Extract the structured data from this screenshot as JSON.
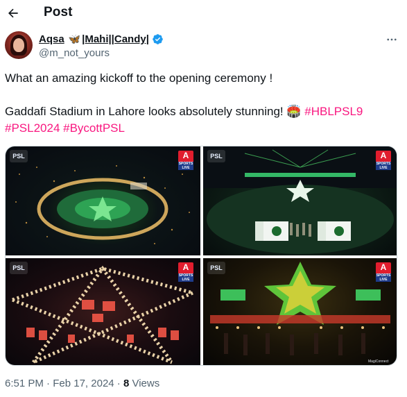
{
  "header": {
    "title": "Post",
    "back_icon": "arrow-left-icon"
  },
  "author": {
    "display_name_part1": "Aqsa",
    "display_name_part2": "|Mahi||Candy|",
    "butterfly_emoji": "🦋",
    "handle": "@m_not_yours",
    "verified": true,
    "verified_color": "#1d9bf0"
  },
  "tweet": {
    "line1": "What an amazing kickoff to the opening ceremony !",
    "line2_text": "Gaddafi Stadium in Lahore looks absolutely stunning! 🏟️ ",
    "hashtags": [
      "#HBLPSL9",
      "#PSL2024",
      "#BycottPSL"
    ],
    "hashtag_color": "#f91880"
  },
  "media": {
    "count": 4,
    "overlay_logo": "PSL",
    "live_badge_letter": "A",
    "live_badge_sub": "SPORTS LIVE",
    "watermark": "MagiConnect"
  },
  "meta": {
    "time": "6:51 PM",
    "date": "Feb 17, 2024",
    "separator": "·",
    "views_count": "8",
    "views_label": "Views"
  },
  "more_icon": "more-horizontal-icon"
}
